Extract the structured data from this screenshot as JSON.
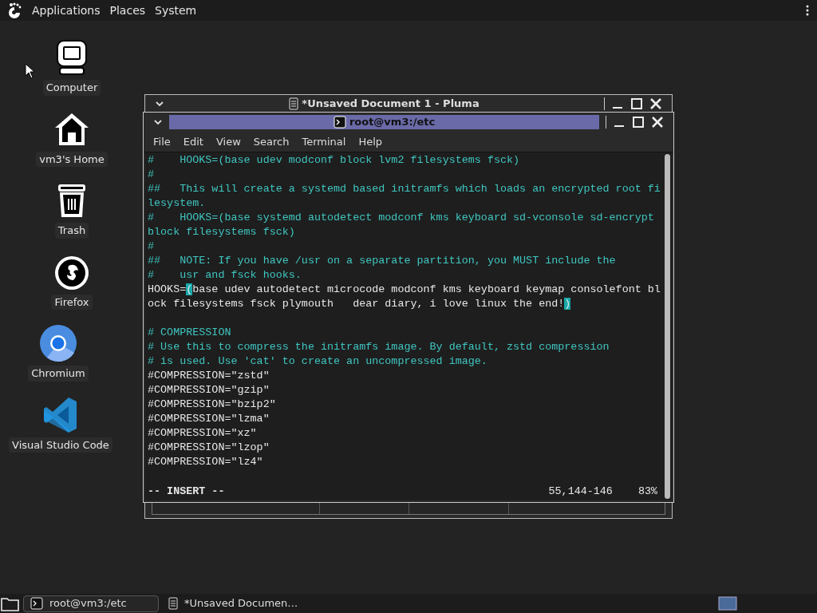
{
  "top_panel": {
    "menus": [
      "Applications",
      "Places",
      "System"
    ]
  },
  "desktop_icons": [
    {
      "kind": "computer",
      "label": "Computer"
    },
    {
      "kind": "home",
      "label": "vm3's Home"
    },
    {
      "kind": "trash",
      "label": "Trash"
    },
    {
      "kind": "firefox",
      "label": "Firefox"
    },
    {
      "kind": "chromium",
      "label": "Chromium"
    },
    {
      "kind": "vscode",
      "label": "Visual Studio Code"
    }
  ],
  "back_window": {
    "title": "*Unsaved Document 1 - Pluma"
  },
  "terminal": {
    "title": "root@vm3:/etc",
    "menus": [
      "File",
      "Edit",
      "View",
      "Search",
      "Terminal",
      "Help"
    ],
    "lines": [
      {
        "segments": [
          {
            "kind": "comment",
            "text": "#    HOOKS=(base udev modconf block lvm2 filesystems fsck)"
          }
        ]
      },
      {
        "segments": [
          {
            "kind": "comment",
            "text": "#"
          }
        ]
      },
      {
        "segments": [
          {
            "kind": "comment",
            "text": "##   This will create a systemd based initramfs which loads an encrypted root fi"
          }
        ]
      },
      {
        "segments": [
          {
            "kind": "comment",
            "text": "lesystem."
          }
        ]
      },
      {
        "segments": [
          {
            "kind": "comment",
            "text": "#    HOOKS=(base systemd autodetect modconf kms keyboard sd-vconsole sd-encrypt"
          }
        ]
      },
      {
        "segments": [
          {
            "kind": "comment",
            "text": "block filesystems fsck)"
          }
        ]
      },
      {
        "segments": [
          {
            "kind": "comment",
            "text": "#"
          }
        ]
      },
      {
        "segments": [
          {
            "kind": "comment",
            "text": "##   NOTE: If you have /usr on a separate partition, you MUST include the"
          }
        ]
      },
      {
        "segments": [
          {
            "kind": "comment",
            "text": "#    usr and fsck hooks."
          }
        ]
      },
      {
        "segments": [
          {
            "kind": "code",
            "text": "HOOKS="
          },
          {
            "kind": "match",
            "text": "("
          },
          {
            "kind": "code",
            "text": "base udev autodetect microcode modconf kms keyboard keymap consolefont bl"
          }
        ]
      },
      {
        "segments": [
          {
            "kind": "code",
            "text": "ock filesystems fsck plymouth   dear diary, i love linux the end!"
          },
          {
            "kind": "match",
            "text": ")"
          }
        ]
      },
      {
        "kind": "blank"
      },
      {
        "segments": [
          {
            "kind": "comment",
            "text": "# COMPRESSION"
          }
        ]
      },
      {
        "segments": [
          {
            "kind": "comment",
            "text": "# Use this to compress the initramfs image. By default, zstd compression"
          }
        ]
      },
      {
        "segments": [
          {
            "kind": "comment",
            "text": "# is used. Use 'cat' to create an uncompressed image."
          }
        ]
      },
      {
        "segments": [
          {
            "kind": "code",
            "text": "#COMPRESSION=\"zstd\""
          }
        ]
      },
      {
        "segments": [
          {
            "kind": "code",
            "text": "#COMPRESSION=\"gzip\""
          }
        ]
      },
      {
        "segments": [
          {
            "kind": "code",
            "text": "#COMPRESSION=\"bzip2\""
          }
        ]
      },
      {
        "segments": [
          {
            "kind": "code",
            "text": "#COMPRESSION=\"lzma\""
          }
        ]
      },
      {
        "segments": [
          {
            "kind": "code",
            "text": "#COMPRESSION=\"xz\""
          }
        ]
      },
      {
        "segments": [
          {
            "kind": "code",
            "text": "#COMPRESSION=\"lzop\""
          }
        ]
      },
      {
        "segments": [
          {
            "kind": "code",
            "text": "#COMPRESSION=\"lz4\""
          }
        ]
      }
    ],
    "mode": "-- INSERT --",
    "position": "55,144-146",
    "percent": "83%"
  },
  "taskbar": {
    "items": [
      {
        "kind": "terminal",
        "label": "root@vm3:/etc",
        "selected": true
      },
      {
        "kind": "document",
        "label": "*Unsaved Documen…",
        "selected": false
      }
    ]
  }
}
